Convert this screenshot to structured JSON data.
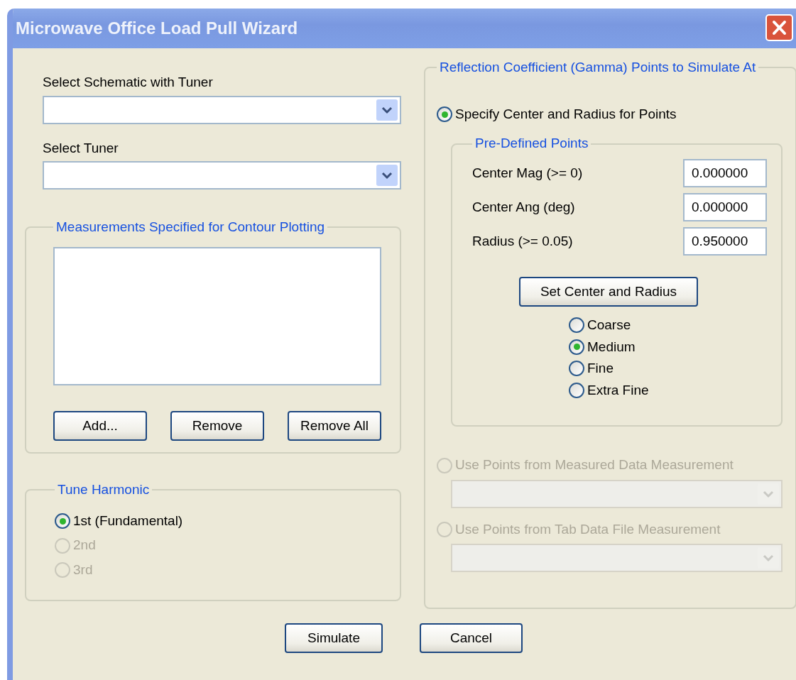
{
  "window": {
    "title": "Microwave Office Load Pull Wizard"
  },
  "schematic": {
    "label": "Select Schematic with Tuner"
  },
  "tuner": {
    "label": "Select Tuner"
  },
  "measurements": {
    "title": "Measurements Specified for Contour Plotting",
    "buttons": [
      "Add...",
      "Remove",
      "Remove All"
    ]
  },
  "tune_harmonic": {
    "title": "Tune Harmonic",
    "options": [
      {
        "label": "1st (Fundamental)",
        "selected": true,
        "disabled": false
      },
      {
        "label": "2nd",
        "selected": false,
        "disabled": true
      },
      {
        "label": "3rd",
        "selected": false,
        "disabled": true
      }
    ]
  },
  "gamma": {
    "title": "Reflection Coefficient (Gamma) Points to Simulate At",
    "modes": [
      {
        "kind": "center_radius",
        "label": "Specify Center and Radius for Points",
        "selected": true,
        "disabled": false
      },
      {
        "kind": "combo",
        "label": "Use Points from Measured Data Measurement",
        "selected": false,
        "disabled": true
      },
      {
        "kind": "combo",
        "label": "Use Points from Tab Data File Measurement",
        "selected": false,
        "disabled": true
      }
    ],
    "predefined": {
      "title": "Pre-Defined Points",
      "fields": [
        {
          "label": "Center Mag (>= 0)",
          "value": "0.000000"
        },
        {
          "label": "Center Ang (deg)",
          "value": "0.000000"
        },
        {
          "label": "Radius (>= 0.05)",
          "value": "0.950000"
        }
      ],
      "button": "Set Center and Radius",
      "resolutions": [
        {
          "label": "Coarse",
          "selected": false
        },
        {
          "label": "Medium",
          "selected": true
        },
        {
          "label": "Fine",
          "selected": false
        },
        {
          "label": "Extra Fine",
          "selected": false
        }
      ]
    }
  },
  "buttons": [
    "Simulate",
    "Cancel"
  ]
}
